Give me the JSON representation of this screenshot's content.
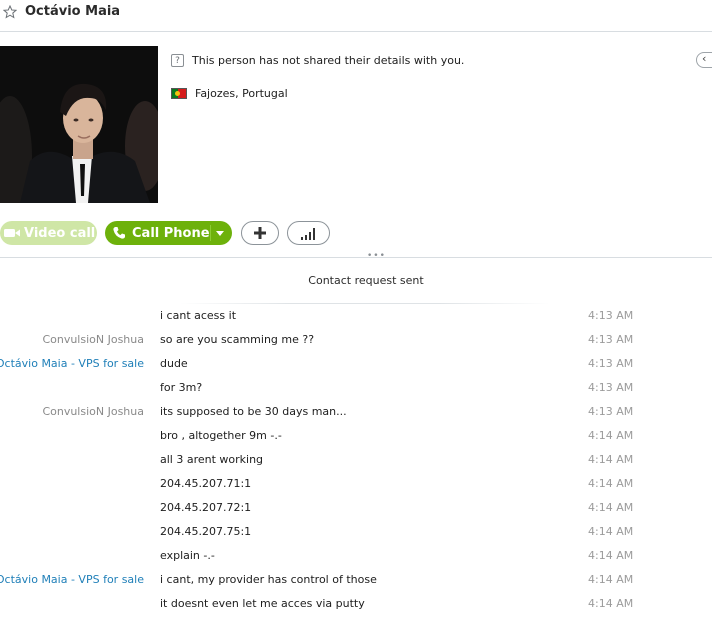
{
  "contact": {
    "name": "Octávio Maia",
    "details_notice": "This person has not shared their details with you.",
    "location": "Fajozes, Portugal"
  },
  "actions": {
    "video_call_label": "Video call",
    "call_phone_label": "Call Phone",
    "add_icon": "plus-icon",
    "signal_icon": "signal-bars-icon"
  },
  "colors": {
    "call_green": "#6db10b",
    "video_disabled": "#cfe6a6",
    "contact_blue": "#1f7fb8"
  },
  "conversation": {
    "notice": "Contact request sent",
    "messages": [
      {
        "sender": "",
        "text": "i cant acess it",
        "time": "4:13 AM",
        "side": "me"
      },
      {
        "sender": "ConvulsioN Joshua",
        "text": "so are you scamming me ??",
        "time": "4:13 AM",
        "side": "me"
      },
      {
        "sender": "Octávio Maia - VPS for sale",
        "text": "dude",
        "time": "4:13 AM",
        "side": "them"
      },
      {
        "sender": "",
        "text": "for 3m?",
        "time": "4:13 AM",
        "side": "them"
      },
      {
        "sender": "ConvulsioN Joshua",
        "text": "its supposed to be 30 days man...",
        "time": "4:13 AM",
        "side": "me"
      },
      {
        "sender": "",
        "text": "bro , altogether 9m -.-",
        "time": "4:14 AM",
        "side": "me"
      },
      {
        "sender": "",
        "text": "all 3 arent working",
        "time": "4:14 AM",
        "side": "me"
      },
      {
        "sender": "",
        "text": "204.45.207.71:1",
        "time": "4:14 AM",
        "side": "me"
      },
      {
        "sender": "",
        "text": "204.45.207.72:1",
        "time": "4:14 AM",
        "side": "me"
      },
      {
        "sender": "",
        "text": "204.45.207.75:1",
        "time": "4:14 AM",
        "side": "me"
      },
      {
        "sender": "",
        "text": "explain -.-",
        "time": "4:14 AM",
        "side": "me"
      },
      {
        "sender": "Octávio Maia - VPS for sale",
        "text": "i cant, my provider has control of those",
        "time": "4:14 AM",
        "side": "them"
      },
      {
        "sender": "",
        "text": "it doesnt even let me acces via putty",
        "time": "4:14 AM",
        "side": "them"
      }
    ]
  }
}
